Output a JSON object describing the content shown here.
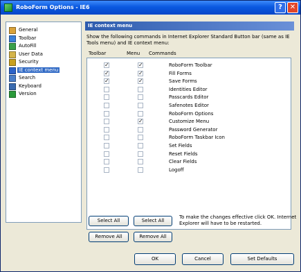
{
  "window": {
    "title": "RoboForm Options - IE6",
    "help_symbol": "?",
    "close_symbol": "✕"
  },
  "sidebar": {
    "items": [
      {
        "label": "General",
        "icon": "general-icon",
        "color": "#d9a23a"
      },
      {
        "label": "Toolbar",
        "icon": "toolbar-icon",
        "color": "#3a7fd9"
      },
      {
        "label": "AutoFill",
        "icon": "autofill-icon",
        "color": "#3aa04a"
      },
      {
        "label": "User Data",
        "icon": "user-data-icon",
        "color": "#d4b44a"
      },
      {
        "label": "Security",
        "icon": "security-icon",
        "color": "#c8a020"
      },
      {
        "label": "IE context menu",
        "icon": "ie-context-menu-icon",
        "color": "#2c63c9",
        "selected": true
      },
      {
        "label": "Search",
        "icon": "search-icon",
        "color": "#4a7fc9"
      },
      {
        "label": "Keyboard",
        "icon": "keyboard-icon",
        "color": "#3a6bb0"
      },
      {
        "label": "Version",
        "icon": "version-icon",
        "color": "#2a9a3a"
      }
    ]
  },
  "panel": {
    "header": "IE context menu",
    "description": "Show the following commands in Internet Explorer Standard Button bar (same as IE Tools menu) and IE context menu:",
    "columns": {
      "toolbar": "Toolbar",
      "menu": "Menu",
      "commands": "Commands"
    },
    "rows": [
      {
        "command": "RoboForm Toolbar",
        "toolbar": true,
        "menu": true
      },
      {
        "command": "Fill Forms",
        "toolbar": true,
        "menu": true
      },
      {
        "command": "Save Forms",
        "toolbar": true,
        "menu": true
      },
      {
        "command": "Identities Editor",
        "toolbar": false,
        "menu": false
      },
      {
        "command": "Passcards Editor",
        "toolbar": false,
        "menu": false
      },
      {
        "command": "Safenotes Editor",
        "toolbar": false,
        "menu": false
      },
      {
        "command": "RoboForm Options",
        "toolbar": false,
        "menu": false
      },
      {
        "command": "Customize Menu",
        "toolbar": false,
        "menu": true
      },
      {
        "command": "Password Generator",
        "toolbar": false,
        "menu": false
      },
      {
        "command": "RoboForm Taskbar Icon",
        "toolbar": false,
        "menu": false
      },
      {
        "command": "Set Fields",
        "toolbar": false,
        "menu": false
      },
      {
        "command": "Reset Fields",
        "toolbar": false,
        "menu": false
      },
      {
        "command": "Clear Fields",
        "toolbar": false,
        "menu": false
      },
      {
        "command": "Logoff",
        "toolbar": false,
        "menu": false
      }
    ],
    "buttons": {
      "select_all_toolbar": "Select All",
      "select_all_menu": "Select All",
      "remove_all_toolbar": "Remove All",
      "remove_all_menu": "Remove All"
    },
    "note": "To make the changes effective click OK. Internet Explorer will have to be restarted."
  },
  "footer": {
    "ok": "OK",
    "cancel": "Cancel",
    "set_defaults": "Set Defaults"
  },
  "colors": {
    "title_bar": "#0a58e0",
    "selection": "#316ac5",
    "panel_header": "#2e5cae"
  }
}
